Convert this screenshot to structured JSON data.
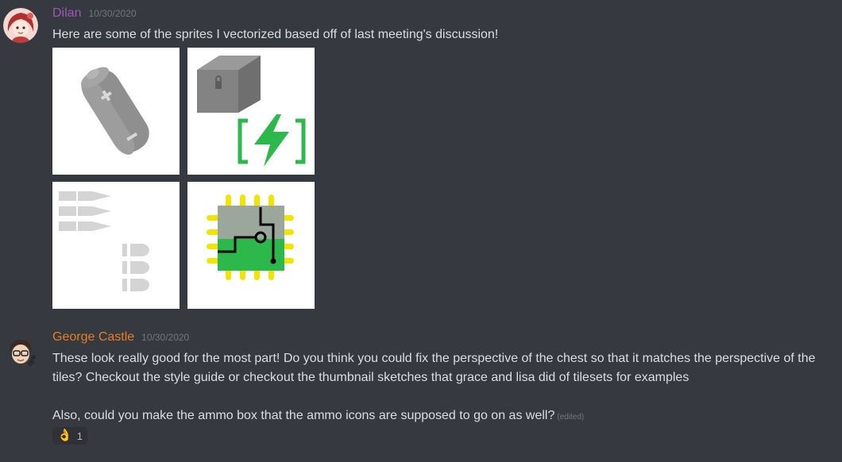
{
  "messages": [
    {
      "author": "Dilan",
      "author_color": "#9b59b6",
      "timestamp": "10/30/2020",
      "text": "Here are some of the sprites I vectorized based off of last meeting's discussion!",
      "attachments": [
        "battery-sprite",
        "chest-sprite",
        "bullets-sprite",
        "chip-sprite"
      ]
    },
    {
      "author": "George Castle",
      "author_color": "#e67e22",
      "timestamp": "10/30/2020",
      "text_1": "These look really good for the most part! Do you think you could fix the perspective of the chest so that it matches the perspective of the tiles? Checkout the style guide or checkout the thumbnail sketches that grace and lisa did of tilesets for examples",
      "text_2": "Also, could you make the ammo box that the ammo icons are supposed to go on as well?",
      "edited_label": "(edited)",
      "reaction": {
        "emoji": "👌",
        "count": "1"
      }
    }
  ],
  "colors": {
    "background": "#36393f",
    "text": "#dcddde",
    "muted": "#72767d",
    "energy_green": "#2db84b",
    "chip_yellow": "#f2e400"
  }
}
